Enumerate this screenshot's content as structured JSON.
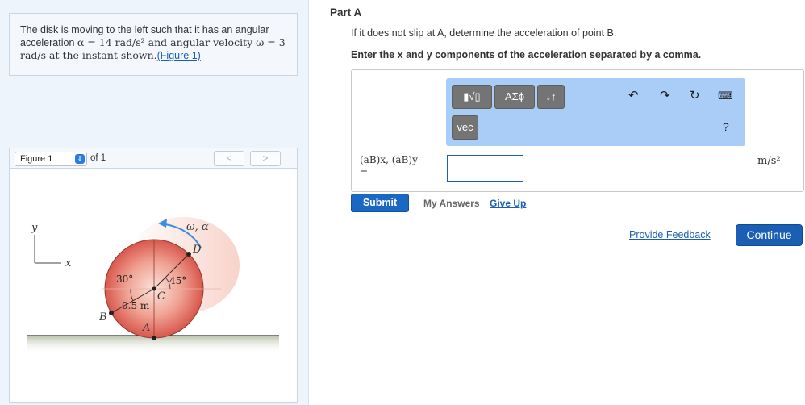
{
  "problem": {
    "text_part1": "The disk is moving to the left such that it has an angular acceleration ",
    "alpha_expr": "α = 14 rad/s² and angular velocity ω = 3",
    "text_part2": "rad/s at the instant shown.",
    "figure_link": "(Figure 1)"
  },
  "figure_nav": {
    "selected": "Figure 1",
    "of_label": "of 1",
    "prev": "<",
    "next": ">"
  },
  "figure": {
    "y_axis": "y",
    "x_axis": "x",
    "omega_alpha": "ω, α",
    "point_d": "D",
    "point_c": "C",
    "point_b": "B",
    "point_a": "A",
    "angle_30": "30°",
    "angle_45": "45°",
    "radius": "0.5 m"
  },
  "part": {
    "title": "Part A",
    "question": "If it does not slip at A, determine the acceleration of point B.",
    "instruction": "Enter the x and y components of the acceleration separated by a comma."
  },
  "toolbar": {
    "templates": "▮√▯",
    "symbols": "ΑΣϕ",
    "arrows": "↓↑",
    "vec": "vec",
    "help": "?"
  },
  "answer": {
    "label_line1": "(aB)x, (aB)y",
    "label_line2": "=",
    "value": "",
    "unit": "m/s²"
  },
  "actions": {
    "submit": "Submit",
    "my_answers": "My Answers",
    "give_up": "Give Up",
    "feedback": "Provide Feedback",
    "continue": "Continue"
  }
}
